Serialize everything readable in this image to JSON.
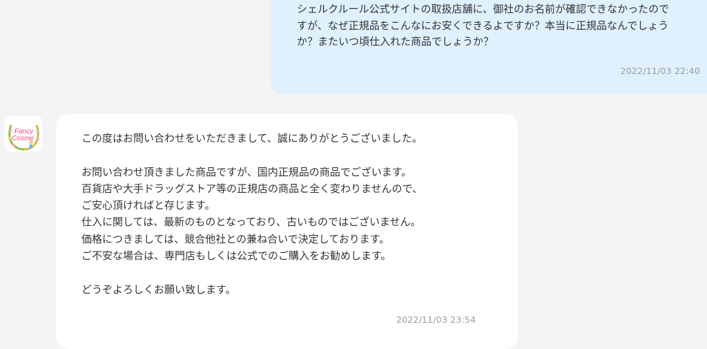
{
  "messages": {
    "outgoing": {
      "lines": [
        "シェルクルール公式サイトの取扱店舗に、御社のお名前が確認できなかったので",
        "すが、なぜ正規品をこんなにお安くできるよですか？本当に正規品なんでしょう",
        "か？またいつ頃仕入れた商品でしょうか？"
      ],
      "time": "2022/11/03 22:40"
    },
    "incoming": {
      "avatar_text": [
        "Fancy",
        "Cosme"
      ],
      "lines": [
        "この度はお問い合わせをいただきまして、誠にありがとうございました。",
        "",
        "お問い合わせ頂きました商品ですが、国内正規品の商品でございます。",
        "百貨店や大手ドラッグストア等の正規店の商品と全く変わりませんので、",
        "ご安心頂ければと存じます。",
        "仕入に関しては、最新のものとなっており、古いものではございません。",
        "価格につきましては、競合他社との兼ね合いで決定しております。",
        "ご不安な場合は、専門店もしくは公式でのご購入をお勧めします。",
        "",
        "どうぞよろしくお願い致します。"
      ],
      "time": "2022/11/03 23:54"
    }
  },
  "colors": {
    "background": "#f4f4f4",
    "outgoing_bubble": "#dff1fd",
    "incoming_bubble": "#ffffff",
    "text": "#333333",
    "timestamp": "#9a9a9a",
    "avatar_text": "#e8487e"
  }
}
